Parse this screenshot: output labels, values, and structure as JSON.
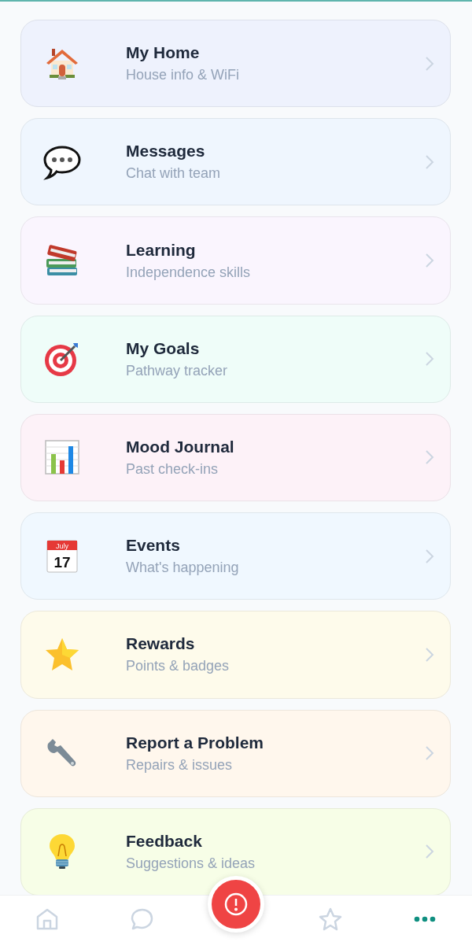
{
  "menu": [
    {
      "title": "My Home",
      "subtitle": "House info & WiFi",
      "color": "#eef2fd"
    },
    {
      "title": "Messages",
      "subtitle": "Chat with team",
      "color": "#eff6fe"
    },
    {
      "title": "Learning",
      "subtitle": "Independence skills",
      "color": "#faf5fe"
    },
    {
      "title": "My Goals",
      "subtitle": "Pathway tracker",
      "color": "#effdf9"
    },
    {
      "title": "Mood Journal",
      "subtitle": "Past check-ins",
      "color": "#fdf2f8"
    },
    {
      "title": "Events",
      "subtitle": "What's happening",
      "color": "#f0f8ff",
      "calendar": {
        "month": "July",
        "day": "17"
      }
    },
    {
      "title": "Rewards",
      "subtitle": "Points & badges",
      "color": "#fefbeb"
    },
    {
      "title": "Report a Problem",
      "subtitle": "Repairs & issues",
      "color": "#fff7ed"
    },
    {
      "title": "Feedback",
      "subtitle": "Suggestions & ideas",
      "color": "#f7fee7"
    }
  ],
  "bottom_nav": [
    {
      "kind": "home",
      "selected": false
    },
    {
      "kind": "chat",
      "selected": false
    },
    {
      "kind": "alert",
      "selected": false
    },
    {
      "kind": "star",
      "selected": false
    },
    {
      "kind": "more",
      "selected": true
    }
  ]
}
